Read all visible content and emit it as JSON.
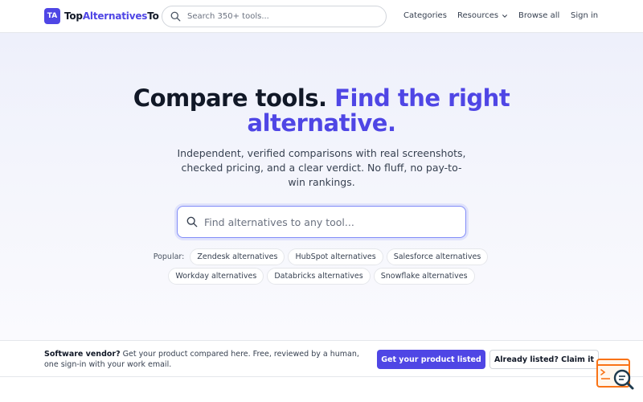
{
  "header": {
    "logo_mark": "TA",
    "logo_name_part1": "Top",
    "logo_name_part2": "Alternatives",
    "logo_name_part3": "To",
    "search_placeholder": "Search 350+ tools...",
    "nav": {
      "categories": "Categories",
      "resources": "Resources",
      "browse_all": "Browse all",
      "sign_in": "Sign in"
    }
  },
  "hero": {
    "title_part1": "Compare tools.",
    "title_part2": "Find the right alternative.",
    "subtitle": "Independent, verified comparisons with real screenshots, checked pricing, and a clear verdict. No fluff, no pay-to-win rankings.",
    "search_placeholder": "Find alternatives to any tool...",
    "popular_label": "Popular:",
    "popular_row1": [
      "Zendesk alternatives",
      "HubSpot alternatives",
      "Salesforce alternatives"
    ],
    "popular_row2": [
      "Workday alternatives",
      "Databricks alternatives",
      "Snowflake alternatives"
    ]
  },
  "vendor_bar": {
    "lead": "Software vendor?",
    "text": " Get your product compared here. Free, reviewed by a human, one sign-in with your work email.",
    "primary_button": "Get your product listed",
    "secondary_button": "Already listed? Claim it"
  },
  "colors": {
    "brand": "#4f46e5",
    "widget_accent": "#f97316"
  }
}
